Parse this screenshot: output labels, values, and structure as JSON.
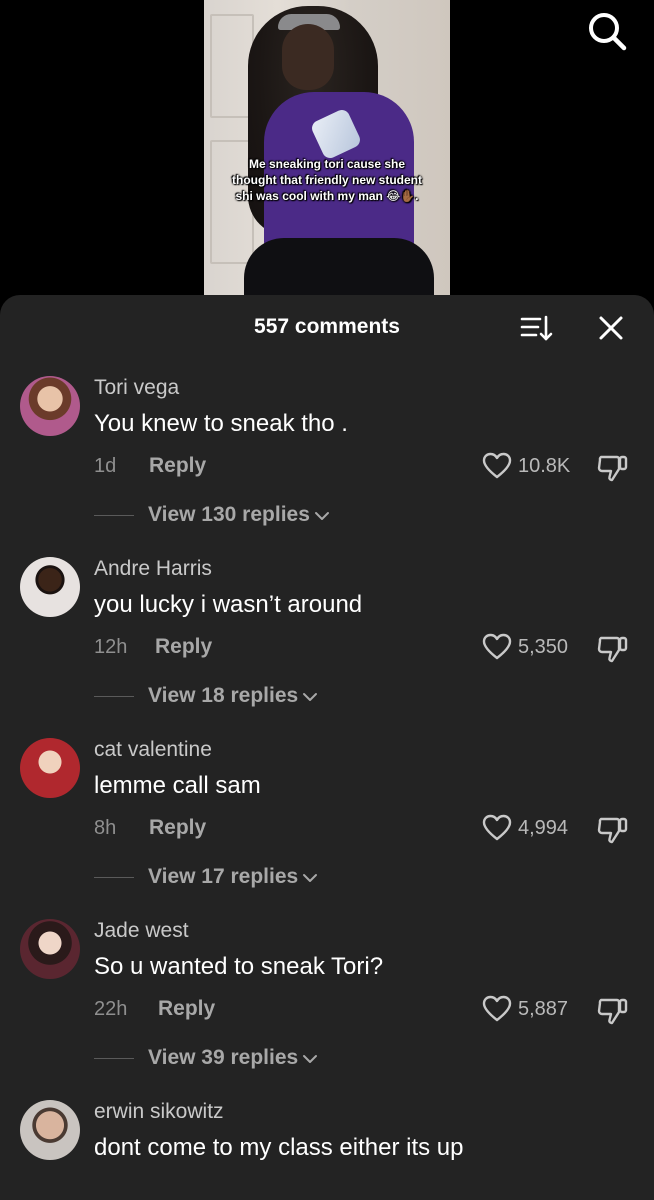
{
  "video": {
    "caption": "Me sneaking tori cause she thought that friendly new student shi was cool with my man 😂✋🏾."
  },
  "header": {
    "comments_count": "557 comments"
  },
  "comments": [
    {
      "username": "Tori vega",
      "text": "You knew to sneak tho .",
      "time": "1d",
      "reply_label": "Reply",
      "likes": "10.8K",
      "view_replies": "View 130 replies",
      "avatar_color": "#b05a8c"
    },
    {
      "username": "Andre Harris",
      "text": "you lucky i wasn’t around",
      "time": "12h",
      "reply_label": "Reply",
      "likes": "5,350",
      "view_replies": "View 18 replies",
      "avatar_color": "#3a2a2a"
    },
    {
      "username": "cat valentine",
      "text": "lemme call sam",
      "time": "8h",
      "reply_label": "Reply",
      "likes": "4,994",
      "view_replies": "View 17 replies",
      "avatar_color": "#b0282e"
    },
    {
      "username": "Jade west",
      "text": "So u wanted to sneak Tori?",
      "time": "22h",
      "reply_label": "Reply",
      "likes": "5,887",
      "view_replies": "View 39 replies",
      "avatar_color": "#5a2630"
    },
    {
      "username": "erwin sikowitz",
      "text": "dont come to my class either its up",
      "time": "",
      "reply_label": "",
      "likes": "",
      "view_replies": "",
      "avatar_color": "#7a6a60"
    }
  ],
  "icons": {
    "search": "search-icon",
    "sort": "sort-icon",
    "close": "close-icon",
    "like": "heart-icon",
    "dislike": "thumbs-down-icon",
    "chevron": "chevron-down-icon"
  }
}
